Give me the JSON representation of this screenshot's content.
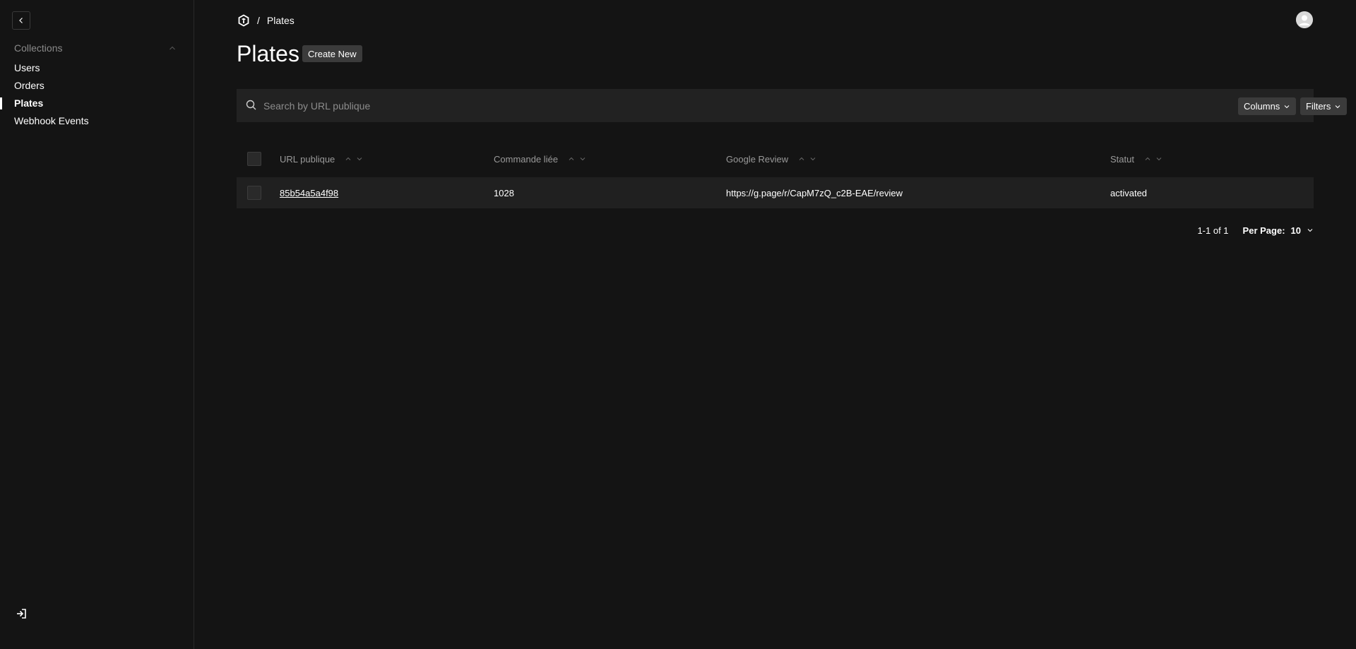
{
  "sidebar": {
    "group_label": "Collections",
    "items": [
      {
        "label": "Users",
        "active": false
      },
      {
        "label": "Orders",
        "active": false
      },
      {
        "label": "Plates",
        "active": true
      },
      {
        "label": "Webhook Events",
        "active": false
      }
    ]
  },
  "header": {
    "breadcrumb_separator": "/",
    "breadcrumb_current": "Plates"
  },
  "page": {
    "title": "Plates",
    "create_label": "Create New"
  },
  "search": {
    "placeholder": "Search by URL publique",
    "value": ""
  },
  "toolbar": {
    "columns_label": "Columns",
    "filters_label": "Filters"
  },
  "table": {
    "columns": [
      "URL publique",
      "Commande liée",
      "Google Review",
      "Statut"
    ],
    "rows": [
      {
        "url": "85b54a5a4f98",
        "order": "1028",
        "review": "https://g.page/r/CapM7zQ_c2B-EAE/review",
        "status": "activated"
      }
    ]
  },
  "pagination": {
    "range": "1-1 of 1",
    "per_page_label": "Per Page:",
    "per_page_value": "10"
  },
  "colors": {
    "background": "#141414",
    "surface": "#222222",
    "row": "#202020",
    "button": "#3b3b3b",
    "muted_text": "#8a8a8a"
  }
}
